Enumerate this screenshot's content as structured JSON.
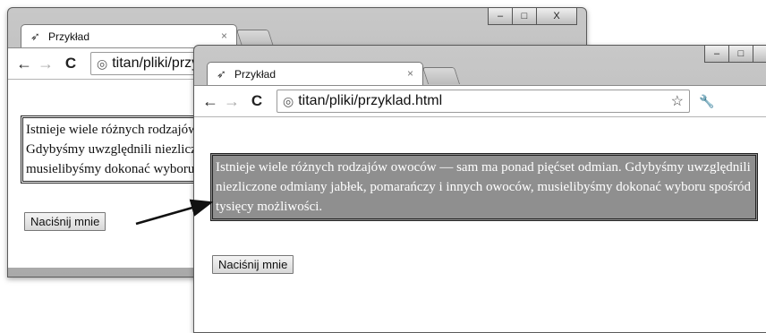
{
  "windows": [
    {
      "tab_title": "Przykład",
      "tab_close": "×",
      "url": "titan/pliki/przyklad.html",
      "paragraph": "Istnieje wiele różnych rodzajów owoców — sam ma ponad pięćset odmian. Gdybyśmy uwzględnili niezliczone odmiany jabłek, pomarańczy i innych owoców, musielibyśmy dokonać wyboru spośród tysięcy możliwości.",
      "button_label": "Naciśnij mnie"
    },
    {
      "tab_title": "Przykład",
      "tab_close": "×",
      "url": "titan/pliki/przyklad.html",
      "paragraph": "Istnieje wiele różnych rodzajów owoców — sam ma ponad pięćset odmian. Gdybyśmy uwzględnili niezliczone odmiany jabłek, pomarańczy i innych owoców, musielibyśmy dokonać wyboru spośród tysięcy możliwości.",
      "button_label": "Naciśnij mnie"
    }
  ],
  "window_controls": {
    "minimize": "–",
    "maximize": "□",
    "close": "X"
  },
  "icons": {
    "favicon": "bird-icon",
    "back": "back-arrow-icon",
    "forward": "forward-arrow-icon",
    "reload": "reload-icon",
    "globe": "globe-icon",
    "star": "star-icon",
    "wrench": "wrench-icon"
  },
  "colors": {
    "highlight_background": "#8f8f8f",
    "highlight_text": "#ffffff"
  }
}
